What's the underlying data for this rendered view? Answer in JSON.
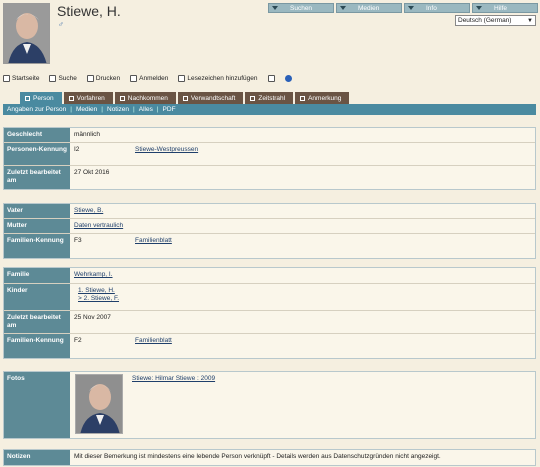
{
  "header": {
    "name": "Stiewe, H.",
    "gender_symbol": "♂"
  },
  "topmenu": [
    {
      "label": "Suchen"
    },
    {
      "label": "Medien"
    },
    {
      "label": "Info"
    },
    {
      "label": "Hilfe"
    }
  ],
  "language": {
    "selected": "Deutsch (German)"
  },
  "toolbar": {
    "home": "Startseite",
    "search": "Suche",
    "print": "Drucken",
    "login": "Anmelden",
    "bookmark": "Lesezeichen hinzufügen"
  },
  "tabs": [
    "Person",
    "Vorfahren",
    "Nachkommen",
    "Verwandtschaft",
    "Zeitstrahl",
    "Anmerkung"
  ],
  "subnav": [
    "Angaben zur Person",
    "Medien",
    "Notizen",
    "Alles",
    "PDF"
  ],
  "person": {
    "gender_label": "Geschlecht",
    "gender_value": "männlich",
    "id_label": "Personen-Kennung",
    "id_value": "I2",
    "id_tree": "Stiewe-Westpreussen",
    "changed_label": "Zuletzt bearbeitet am",
    "changed_value": "27 Okt 2016"
  },
  "parents": {
    "father_label": "Vater",
    "father_value": "Stiewe, B.",
    "mother_label": "Mutter",
    "mother_value": "Daten vertraulich",
    "fam_label": "Familien-Kennung",
    "fam_value": "F3",
    "fam_link": "Familienblatt"
  },
  "family": {
    "family_label": "Familie",
    "family_value": "Wehrkamp, I.",
    "children_label": "Kinder",
    "children": [
      "1. Stiewe, H.",
      "> 2. Stiewe, F."
    ],
    "changed_label": "Zuletzt bearbeitet am",
    "changed_value": "25 Nov 2007",
    "fam_label": "Familien-Kennung",
    "fam_value": "F2",
    "fam_link": "Familienblatt"
  },
  "photos": {
    "label": "Fotos",
    "caption": "Stiewe: Hilmar Stiewe : 2009"
  },
  "notes": {
    "label": "Notizen",
    "text": "Mit dieser Bemerkung ist mindestens eine lebende Person verknüpft - Details werden aus Datenschutzgründen nicht angezeigt."
  }
}
